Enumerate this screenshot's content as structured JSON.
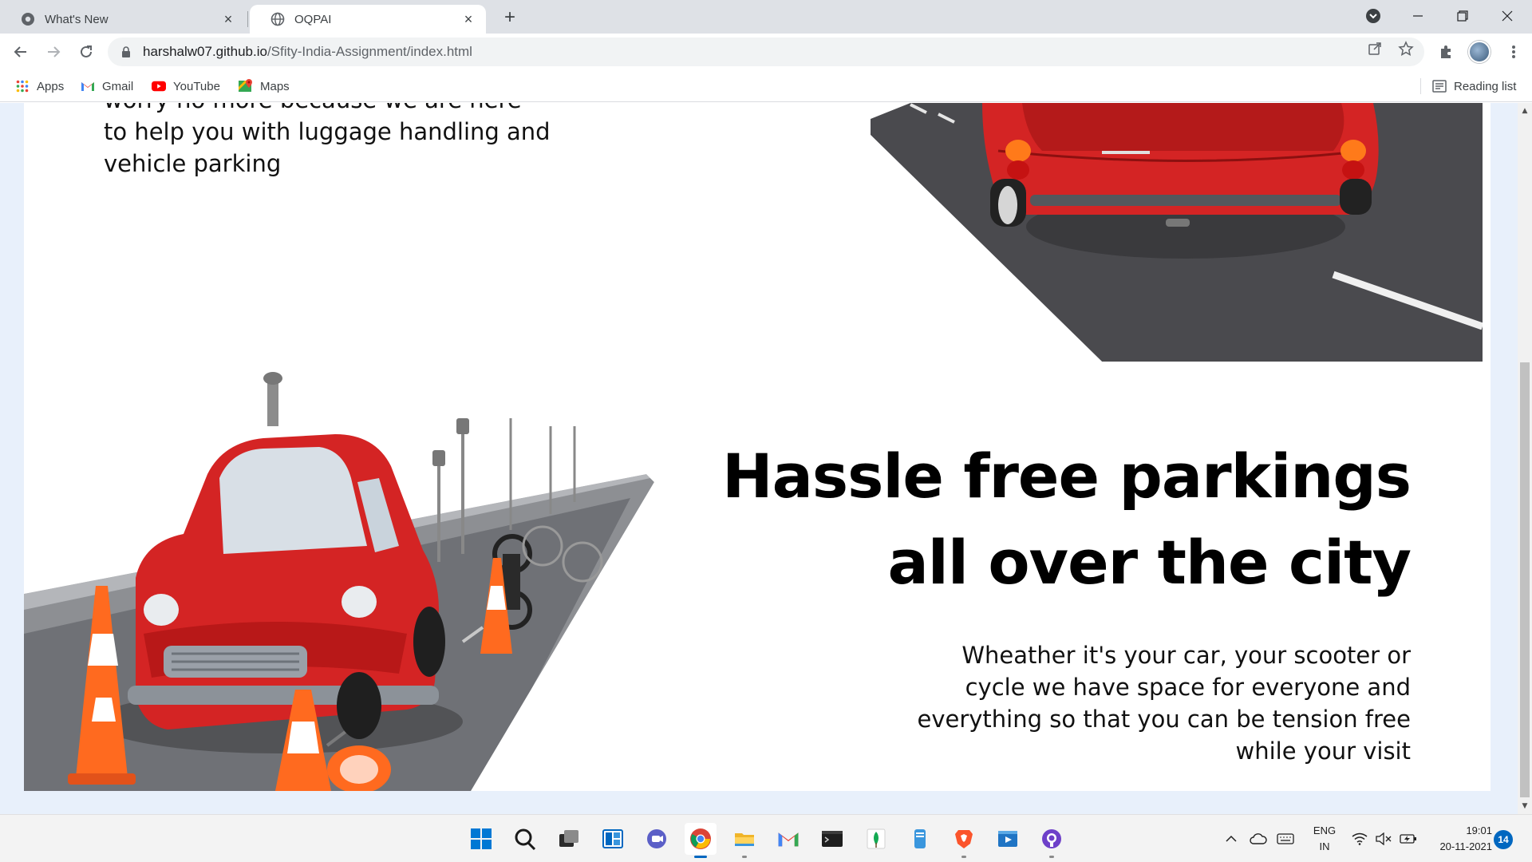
{
  "browser": {
    "tabs": [
      {
        "title": "What's New",
        "active": false,
        "close": "×"
      },
      {
        "title": "OQPAI",
        "active": true,
        "close": "×"
      }
    ],
    "new_tab": "+",
    "address": {
      "host": "harshalw07.github.io",
      "path": "/Sfity-India-Assignment/index.html"
    },
    "bookmarks": [
      {
        "label": "Apps",
        "icon": "apps-grid-icon"
      },
      {
        "label": "Gmail",
        "icon": "gmail-icon"
      },
      {
        "label": "YouTube",
        "icon": "youtube-icon"
      },
      {
        "label": "Maps",
        "icon": "maps-icon"
      }
    ],
    "reading_list": "Reading list"
  },
  "page": {
    "intro_text": "worry no more because we are here to help you with luggage handling and vehicle parking",
    "hero_title_line1": "Hassle free parkings",
    "hero_title_line2": "all over the city",
    "hero_text": "Wheather it's your car, your scooter or cycle we have space for everyone and everything so that you can be tension free while your visit"
  },
  "taskbar": {
    "apps": [
      "start-icon",
      "search-icon",
      "task-view-icon",
      "widgets-icon",
      "teams-chat-icon",
      "chrome-icon",
      "file-explorer-icon",
      "gmail-icon",
      "terminal-icon",
      "mongodb-icon",
      "notepad-icon",
      "brave-icon",
      "video-player-icon",
      "github-desktop-icon"
    ],
    "language_line1": "ENG",
    "language_line2": "IN",
    "time": "19:01",
    "date": "20-11-2021",
    "notifications": "14"
  },
  "colors": {
    "car_red": "#d42424",
    "page_bg": "#e8f0fb",
    "accent": "#0067c0"
  }
}
